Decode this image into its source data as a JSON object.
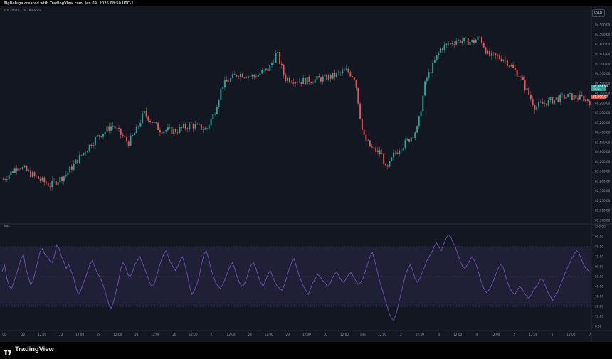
{
  "header": {
    "attribution": "BigBoluga created with TradingView.com, Jan 09, 2026 08:50 UTC-1"
  },
  "chart": {
    "symbol_label": "BTCUSDT · 1h · Binance",
    "currency": "USDT",
    "indicator_label": "MFI",
    "last_price": "90,364.90",
    "countdown": "09:10",
    "secondary_price": "89,900.00"
  },
  "footer": {
    "brand": "TradingView"
  },
  "colors": {
    "up": "#26a69a",
    "down": "#ef5350",
    "mfi_line": "#7e57c2",
    "background": "#131722"
  },
  "chart_data": [
    {
      "type": "candlestick",
      "title": "BTCUSDT · 1h · Binance",
      "y_ticks": [
        "94,500.00",
        "93,500.00",
        "92,600.00",
        "91,800.00",
        "91,100.00",
        "90,300.00",
        "89,500.00",
        "88,700.00",
        "88,200.00",
        "87,700.00",
        "87,200.00",
        "86,400.00",
        "85,600.00",
        "84,600.00",
        "84,200.00",
        "83,700.00",
        "83,200.00",
        "82,700.00",
        "82,250.00",
        "81,810.00",
        "81,370.00"
      ],
      "ylim": [
        81200,
        94700
      ],
      "x_ticks": [
        "00",
        "22",
        "12:00",
        "23",
        "12:00",
        "24",
        "12:00",
        "25",
        "12:00",
        "26",
        "12:00",
        "27",
        "12:00",
        "28",
        "12:00",
        "29",
        "12:00",
        "30",
        "12:00",
        "Dec",
        "12:00",
        "2",
        "12:00",
        "3",
        "12:00",
        "4",
        "12:00",
        "5",
        "12:00",
        "6",
        "12:00",
        "7"
      ],
      "close_path": [
        {
          "x": 0,
          "y": 84100
        },
        {
          "x": 4,
          "y": 85000
        },
        {
          "x": 8,
          "y": 84300
        },
        {
          "x": 12,
          "y": 83700
        },
        {
          "x": 16,
          "y": 84400
        },
        {
          "x": 20,
          "y": 85700
        },
        {
          "x": 24,
          "y": 86900
        },
        {
          "x": 28,
          "y": 87700
        },
        {
          "x": 32,
          "y": 86500
        },
        {
          "x": 34,
          "y": 87300
        },
        {
          "x": 36,
          "y": 88500
        },
        {
          "x": 40,
          "y": 87400
        },
        {
          "x": 44,
          "y": 87300
        },
        {
          "x": 48,
          "y": 87700
        },
        {
          "x": 52,
          "y": 87400
        },
        {
          "x": 54,
          "y": 88500
        },
        {
          "x": 56,
          "y": 90300
        },
        {
          "x": 60,
          "y": 91100
        },
        {
          "x": 64,
          "y": 90900
        },
        {
          "x": 68,
          "y": 91400
        },
        {
          "x": 70,
          "y": 92500
        },
        {
          "x": 72,
          "y": 90800
        },
        {
          "x": 76,
          "y": 90600
        },
        {
          "x": 80,
          "y": 90700
        },
        {
          "x": 84,
          "y": 90900
        },
        {
          "x": 88,
          "y": 91300
        },
        {
          "x": 90,
          "y": 90800
        },
        {
          "x": 92,
          "y": 87000
        },
        {
          "x": 94,
          "y": 86200
        },
        {
          "x": 97,
          "y": 85700
        },
        {
          "x": 98,
          "y": 84600
        },
        {
          "x": 100,
          "y": 85800
        },
        {
          "x": 104,
          "y": 86800
        },
        {
          "x": 106,
          "y": 87500
        },
        {
          "x": 108,
          "y": 90600
        },
        {
          "x": 112,
          "y": 92800
        },
        {
          "x": 116,
          "y": 93300
        },
        {
          "x": 120,
          "y": 93200
        },
        {
          "x": 122,
          "y": 93500
        },
        {
          "x": 124,
          "y": 92300
        },
        {
          "x": 128,
          "y": 92100
        },
        {
          "x": 132,
          "y": 91000
        },
        {
          "x": 136,
          "y": 88900
        },
        {
          "x": 140,
          "y": 89300
        },
        {
          "x": 144,
          "y": 89600
        },
        {
          "x": 148,
          "y": 89500
        },
        {
          "x": 150,
          "y": 89300
        }
      ]
    },
    {
      "type": "line",
      "title": "MFI",
      "y_ticks": [
        "100.00",
        "90.00",
        "80.00",
        "70.00",
        "60.00",
        "50.00",
        "40.00",
        "30.00",
        "20.00",
        "10.00",
        "0.00"
      ],
      "ylim": [
        0,
        100
      ],
      "band": [
        20,
        80
      ],
      "series": [
        {
          "values": [
            55,
            62,
            48,
            40,
            38,
            45,
            52,
            60,
            68,
            72,
            58,
            50,
            42,
            45,
            55,
            65,
            75,
            78,
            72,
            70,
            66,
            64,
            70,
            82,
            78,
            70,
            65,
            58,
            62,
            56,
            50,
            40,
            32,
            35,
            42,
            48,
            55,
            62,
            66,
            60,
            54,
            50,
            45,
            38,
            30,
            22,
            18,
            25,
            35,
            45,
            58,
            64,
            60,
            52,
            50,
            55,
            62,
            66,
            70,
            64,
            58,
            52,
            45,
            40,
            42,
            50,
            58,
            66,
            72,
            76,
            70,
            64,
            60,
            56,
            60,
            66,
            70,
            62,
            52,
            40,
            32,
            36,
            42,
            50,
            62,
            72,
            76,
            68,
            58,
            50,
            44,
            40,
            38,
            42,
            48,
            54,
            60,
            64,
            58,
            50,
            44,
            40,
            42,
            48,
            56,
            62,
            64,
            58,
            50,
            44,
            40,
            46,
            52,
            56,
            50,
            44,
            40,
            38,
            36,
            42,
            50,
            58,
            64,
            68,
            60,
            52,
            46,
            40,
            36,
            32,
            38,
            44,
            48,
            52,
            50,
            46,
            44,
            40,
            42,
            48,
            52,
            55,
            50,
            46,
            44,
            48,
            52,
            54,
            50,
            46,
            42,
            44,
            48,
            55,
            62,
            70,
            74,
            66,
            56,
            46,
            38,
            30,
            22,
            14,
            8,
            6,
            12,
            22,
            32,
            42,
            52,
            58,
            62,
            56,
            48,
            44,
            48,
            54,
            60,
            66,
            70,
            74,
            80,
            84,
            80,
            76,
            82,
            88,
            92,
            90,
            84,
            80,
            72,
            66,
            60,
            58,
            62,
            66,
            70,
            66,
            60,
            52,
            44,
            38,
            34,
            36,
            40,
            46,
            52,
            58,
            62,
            60,
            52,
            44,
            38,
            34,
            32,
            36,
            40,
            38,
            34,
            30,
            28,
            32,
            36,
            40,
            44,
            48,
            46,
            40,
            34,
            30,
            26,
            30,
            34,
            40,
            46,
            52,
            58,
            62,
            68,
            72,
            76,
            74,
            68,
            62,
            58,
            56,
            54
          ]
        }
      ]
    }
  ]
}
